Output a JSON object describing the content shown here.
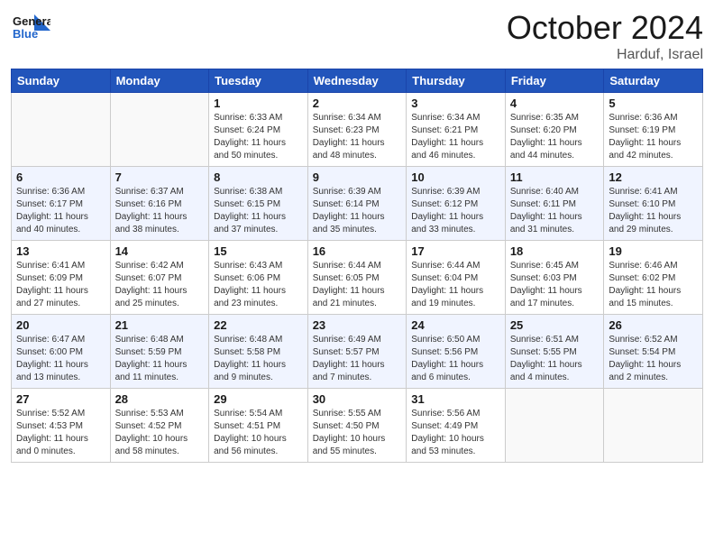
{
  "header": {
    "logo_general": "General",
    "logo_blue": "Blue",
    "month_title": "October 2024",
    "location": "Harduf, Israel"
  },
  "days_of_week": [
    "Sunday",
    "Monday",
    "Tuesday",
    "Wednesday",
    "Thursday",
    "Friday",
    "Saturday"
  ],
  "weeks": [
    [
      {
        "day": "",
        "sunrise": "",
        "sunset": "",
        "daylight": ""
      },
      {
        "day": "",
        "sunrise": "",
        "sunset": "",
        "daylight": ""
      },
      {
        "day": "1",
        "sunrise": "Sunrise: 6:33 AM",
        "sunset": "Sunset: 6:24 PM",
        "daylight": "Daylight: 11 hours and 50 minutes."
      },
      {
        "day": "2",
        "sunrise": "Sunrise: 6:34 AM",
        "sunset": "Sunset: 6:23 PM",
        "daylight": "Daylight: 11 hours and 48 minutes."
      },
      {
        "day": "3",
        "sunrise": "Sunrise: 6:34 AM",
        "sunset": "Sunset: 6:21 PM",
        "daylight": "Daylight: 11 hours and 46 minutes."
      },
      {
        "day": "4",
        "sunrise": "Sunrise: 6:35 AM",
        "sunset": "Sunset: 6:20 PM",
        "daylight": "Daylight: 11 hours and 44 minutes."
      },
      {
        "day": "5",
        "sunrise": "Sunrise: 6:36 AM",
        "sunset": "Sunset: 6:19 PM",
        "daylight": "Daylight: 11 hours and 42 minutes."
      }
    ],
    [
      {
        "day": "6",
        "sunrise": "Sunrise: 6:36 AM",
        "sunset": "Sunset: 6:17 PM",
        "daylight": "Daylight: 11 hours and 40 minutes."
      },
      {
        "day": "7",
        "sunrise": "Sunrise: 6:37 AM",
        "sunset": "Sunset: 6:16 PM",
        "daylight": "Daylight: 11 hours and 38 minutes."
      },
      {
        "day": "8",
        "sunrise": "Sunrise: 6:38 AM",
        "sunset": "Sunset: 6:15 PM",
        "daylight": "Daylight: 11 hours and 37 minutes."
      },
      {
        "day": "9",
        "sunrise": "Sunrise: 6:39 AM",
        "sunset": "Sunset: 6:14 PM",
        "daylight": "Daylight: 11 hours and 35 minutes."
      },
      {
        "day": "10",
        "sunrise": "Sunrise: 6:39 AM",
        "sunset": "Sunset: 6:12 PM",
        "daylight": "Daylight: 11 hours and 33 minutes."
      },
      {
        "day": "11",
        "sunrise": "Sunrise: 6:40 AM",
        "sunset": "Sunset: 6:11 PM",
        "daylight": "Daylight: 11 hours and 31 minutes."
      },
      {
        "day": "12",
        "sunrise": "Sunrise: 6:41 AM",
        "sunset": "Sunset: 6:10 PM",
        "daylight": "Daylight: 11 hours and 29 minutes."
      }
    ],
    [
      {
        "day": "13",
        "sunrise": "Sunrise: 6:41 AM",
        "sunset": "Sunset: 6:09 PM",
        "daylight": "Daylight: 11 hours and 27 minutes."
      },
      {
        "day": "14",
        "sunrise": "Sunrise: 6:42 AM",
        "sunset": "Sunset: 6:07 PM",
        "daylight": "Daylight: 11 hours and 25 minutes."
      },
      {
        "day": "15",
        "sunrise": "Sunrise: 6:43 AM",
        "sunset": "Sunset: 6:06 PM",
        "daylight": "Daylight: 11 hours and 23 minutes."
      },
      {
        "day": "16",
        "sunrise": "Sunrise: 6:44 AM",
        "sunset": "Sunset: 6:05 PM",
        "daylight": "Daylight: 11 hours and 21 minutes."
      },
      {
        "day": "17",
        "sunrise": "Sunrise: 6:44 AM",
        "sunset": "Sunset: 6:04 PM",
        "daylight": "Daylight: 11 hours and 19 minutes."
      },
      {
        "day": "18",
        "sunrise": "Sunrise: 6:45 AM",
        "sunset": "Sunset: 6:03 PM",
        "daylight": "Daylight: 11 hours and 17 minutes."
      },
      {
        "day": "19",
        "sunrise": "Sunrise: 6:46 AM",
        "sunset": "Sunset: 6:02 PM",
        "daylight": "Daylight: 11 hours and 15 minutes."
      }
    ],
    [
      {
        "day": "20",
        "sunrise": "Sunrise: 6:47 AM",
        "sunset": "Sunset: 6:00 PM",
        "daylight": "Daylight: 11 hours and 13 minutes."
      },
      {
        "day": "21",
        "sunrise": "Sunrise: 6:48 AM",
        "sunset": "Sunset: 5:59 PM",
        "daylight": "Daylight: 11 hours and 11 minutes."
      },
      {
        "day": "22",
        "sunrise": "Sunrise: 6:48 AM",
        "sunset": "Sunset: 5:58 PM",
        "daylight": "Daylight: 11 hours and 9 minutes."
      },
      {
        "day": "23",
        "sunrise": "Sunrise: 6:49 AM",
        "sunset": "Sunset: 5:57 PM",
        "daylight": "Daylight: 11 hours and 7 minutes."
      },
      {
        "day": "24",
        "sunrise": "Sunrise: 6:50 AM",
        "sunset": "Sunset: 5:56 PM",
        "daylight": "Daylight: 11 hours and 6 minutes."
      },
      {
        "day": "25",
        "sunrise": "Sunrise: 6:51 AM",
        "sunset": "Sunset: 5:55 PM",
        "daylight": "Daylight: 11 hours and 4 minutes."
      },
      {
        "day": "26",
        "sunrise": "Sunrise: 6:52 AM",
        "sunset": "Sunset: 5:54 PM",
        "daylight": "Daylight: 11 hours and 2 minutes."
      }
    ],
    [
      {
        "day": "27",
        "sunrise": "Sunrise: 5:52 AM",
        "sunset": "Sunset: 4:53 PM",
        "daylight": "Daylight: 11 hours and 0 minutes."
      },
      {
        "day": "28",
        "sunrise": "Sunrise: 5:53 AM",
        "sunset": "Sunset: 4:52 PM",
        "daylight": "Daylight: 10 hours and 58 minutes."
      },
      {
        "day": "29",
        "sunrise": "Sunrise: 5:54 AM",
        "sunset": "Sunset: 4:51 PM",
        "daylight": "Daylight: 10 hours and 56 minutes."
      },
      {
        "day": "30",
        "sunrise": "Sunrise: 5:55 AM",
        "sunset": "Sunset: 4:50 PM",
        "daylight": "Daylight: 10 hours and 55 minutes."
      },
      {
        "day": "31",
        "sunrise": "Sunrise: 5:56 AM",
        "sunset": "Sunset: 4:49 PM",
        "daylight": "Daylight: 10 hours and 53 minutes."
      },
      {
        "day": "",
        "sunrise": "",
        "sunset": "",
        "daylight": ""
      },
      {
        "day": "",
        "sunrise": "",
        "sunset": "",
        "daylight": ""
      }
    ]
  ]
}
